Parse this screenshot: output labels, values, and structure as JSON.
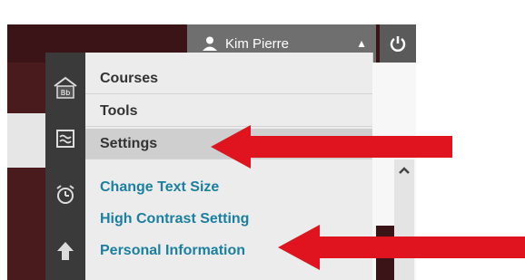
{
  "header": {
    "user_name": "Kim Pierre",
    "user_icon": "user-icon",
    "power_icon": "power-icon"
  },
  "sidebar_icons": [
    "blackboard-home-icon",
    "grades-icon",
    "calendar-alarm-icon",
    "upload-arrow-icon"
  ],
  "menu": {
    "items": [
      {
        "label": "Courses"
      },
      {
        "label": "Tools"
      },
      {
        "label": "Settings"
      }
    ],
    "settings_links": [
      {
        "label": "Change Text Size"
      },
      {
        "label": "High Contrast Setting"
      },
      {
        "label": "Personal Information"
      }
    ]
  },
  "colors": {
    "topbar": "#3a1416",
    "link": "#1b7f9f",
    "annotation_arrow": "#e0141e"
  }
}
